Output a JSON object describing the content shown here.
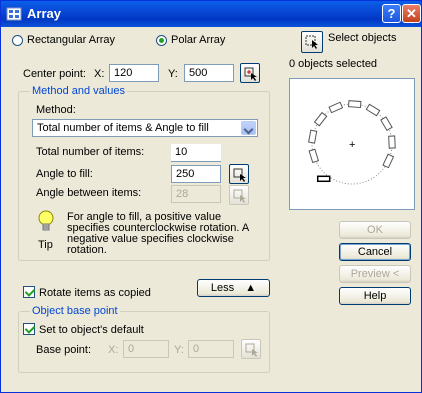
{
  "window": {
    "title": "Array",
    "help_glyph": "?",
    "close_glyph": "✕"
  },
  "array_type": {
    "rectangular_label": "Rectangular Array",
    "polar_label": "Polar Array",
    "selected": "polar"
  },
  "select_objects": {
    "label": "Select objects",
    "status": "0 objects selected"
  },
  "center_point": {
    "label": "Center point:",
    "x_label": "X:",
    "x_value": "120",
    "y_label": "Y:",
    "y_value": "500"
  },
  "method_values": {
    "group_title": "Method and values",
    "method_label": "Method:",
    "method_value": "Total number of items & Angle to fill",
    "total_items_label": "Total number of items:",
    "total_items_value": "10",
    "angle_fill_label": "Angle to fill:",
    "angle_fill_value": "250",
    "angle_between_label": "Angle between items:",
    "angle_between_value": "28"
  },
  "tip": {
    "label": "Tip",
    "text": "For angle to fill, a positive value specifies counterclockwise rotation.  A negative value specifies clockwise rotation."
  },
  "rotate_items": {
    "label": "Rotate items as copied",
    "checked": true
  },
  "less_button": {
    "label": "Less",
    "glyph": "▲"
  },
  "object_base_point": {
    "group_title": "Object base point",
    "default_label": "Set to object's default",
    "default_checked": true,
    "base_point_label": "Base point:",
    "x_label": "X:",
    "x_value": "0",
    "y_label": "Y:",
    "y_value": "0"
  },
  "buttons": {
    "ok": "OK",
    "cancel": "Cancel",
    "preview": "Preview <",
    "help": "Help"
  },
  "colors": {
    "titlebar": "#0a48d6",
    "group_title": "#0046d5",
    "face": "#ece9d8"
  }
}
